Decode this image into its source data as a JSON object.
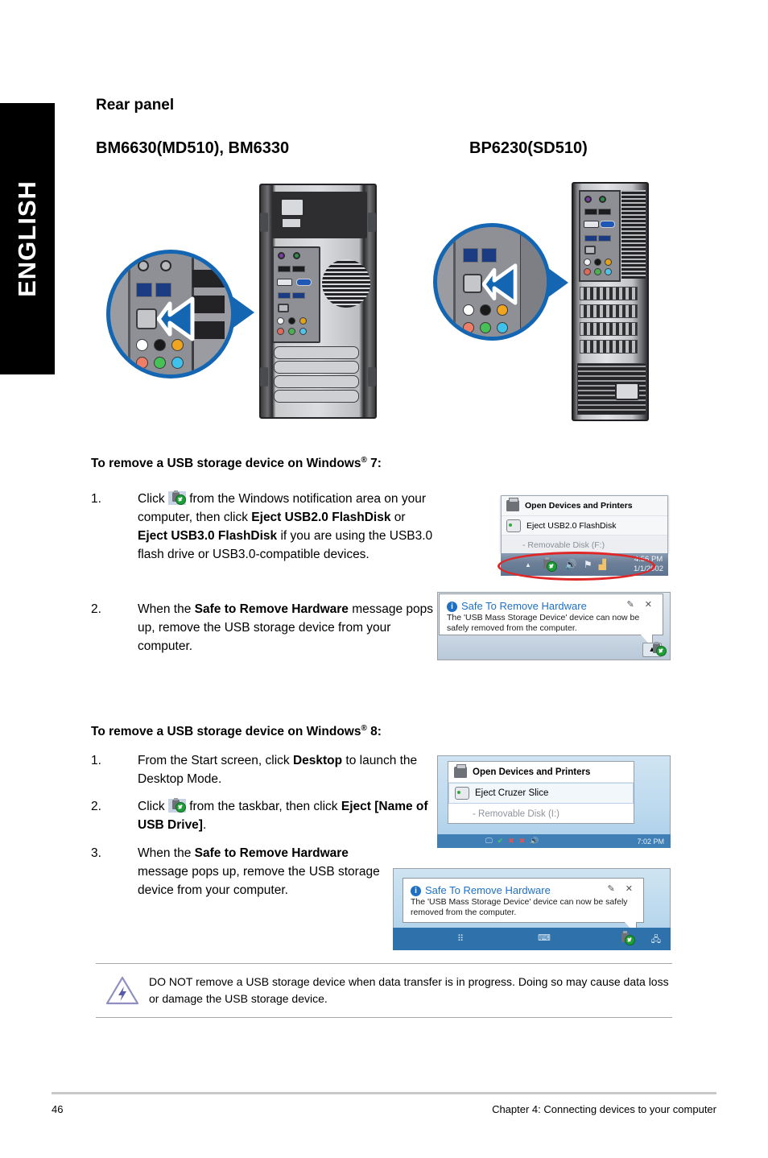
{
  "language_tab": "ENGLISH",
  "headings": {
    "section": "Rear panel",
    "model_left": "BM6630(MD510), BM6330",
    "model_right": "BP6230(SD510)"
  },
  "win7_section": {
    "title_prefix": "To remove a USB storage device on Windows",
    "title_sup": "®",
    "title_suffix": " 7:",
    "steps": [
      {
        "num": "1.",
        "text_parts": [
          {
            "t": "Click ",
            "bold": false
          },
          {
            "t": "[usb-icon]",
            "bold": false
          },
          {
            "t": " from the Windows notification area on your computer, then click ",
            "bold": false
          },
          {
            "t": "Eject USB2.0 FlashDisk",
            "bold": true
          },
          {
            "t": " or ",
            "bold": false
          },
          {
            "t": "Eject USB3.0 FlashDisk",
            "bold": true
          },
          {
            "t": " if you are using the USB3.0 flash drive or USB3.0-compatible devices.",
            "bold": false
          }
        ]
      },
      {
        "num": "2.",
        "text_parts": [
          {
            "t": "When the ",
            "bold": false
          },
          {
            "t": "Safe to Remove Hardware",
            "bold": true
          },
          {
            "t": " message pops up, remove the USB storage device from your computer.",
            "bold": false
          }
        ]
      }
    ]
  },
  "win8_section": {
    "title_prefix": "To remove a USB storage device on Windows",
    "title_sup": "®",
    "title_suffix": " 8:",
    "steps": [
      {
        "num": "1.",
        "text_parts": [
          {
            "t": "From the Start screen, click ",
            "bold": false
          },
          {
            "t": "Desktop",
            "bold": true
          },
          {
            "t": " to launch the Desktop Mode.",
            "bold": false
          }
        ]
      },
      {
        "num": "2.",
        "text_parts": [
          {
            "t": "Click ",
            "bold": false
          },
          {
            "t": "[usb-icon]",
            "bold": false
          },
          {
            "t": " from the taskbar, then click ",
            "bold": false
          },
          {
            "t": "Eject [Name of USB Drive]",
            "bold": true
          },
          {
            "t": ".",
            "bold": false
          }
        ]
      },
      {
        "num": "3.",
        "text_parts": [
          {
            "t": "When the ",
            "bold": false
          },
          {
            "t": "Safe to Remove Hardware",
            "bold": true
          },
          {
            "t": " message pops up, remove the USB storage device from your computer.",
            "bold": false
          }
        ]
      }
    ]
  },
  "win7_flyout": {
    "header": "Open Devices and Printers",
    "eject_item": "Eject USB2.0 FlashDisk",
    "sub_item": "-   Removable Disk (F:)",
    "clock_time": "4:56 PM",
    "clock_date": "1/1/2002"
  },
  "win7_balloon": {
    "title": "Safe To Remove Hardware",
    "info_glyph": "i",
    "body": "The 'USB Mass Storage Device' device can now be safely removed from the computer.",
    "controls": "✎ ✕"
  },
  "win8_flyout": {
    "header": "Open Devices and Printers",
    "eject_item": "Eject Cruzer Slice",
    "sub_item": "-   Removable Disk (I:)",
    "clock_time": "7:02 PM"
  },
  "win8_balloon": {
    "title": "Safe To Remove Hardware",
    "info_glyph": "i",
    "body": "The 'USB Mass Storage Device' device can now be safely removed from the computer.",
    "controls": "✎ ✕"
  },
  "note": {
    "text": "DO NOT remove a USB storage device when data transfer is in progress. Doing so may cause data loss or damage the USB storage device."
  },
  "footer": {
    "page_number": "46",
    "chapter": "Chapter 4: Connecting devices to your computer"
  },
  "colors": {
    "accent_blue": "#1466b3",
    "red_highlight": "#e02626",
    "balloon_blue": "#1e70c4",
    "tab_black": "#000000"
  }
}
